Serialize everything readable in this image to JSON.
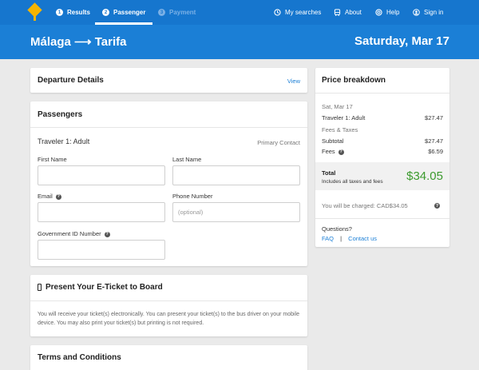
{
  "nav": {
    "steps": [
      {
        "num": "1",
        "label": "Results"
      },
      {
        "num": "2",
        "label": "Passenger"
      },
      {
        "num": "3",
        "label": "Payment"
      }
    ],
    "links": {
      "my_searches": "My searches",
      "about": "About",
      "help": "Help",
      "sign_in": "Sign in"
    }
  },
  "route": {
    "from": "Málaga",
    "arrow": "⟶",
    "to": "Tarifa",
    "date": "Saturday, Mar 17"
  },
  "departure": {
    "title": "Departure Details",
    "view_link": "View"
  },
  "passengers": {
    "title": "Passengers",
    "traveler": "Traveler 1: Adult",
    "primary": "Primary Contact",
    "first_name_label": "First Name",
    "last_name_label": "Last Name",
    "email_label": "Email",
    "phone_label": "Phone Number",
    "phone_placeholder": "(optional)",
    "gov_id_label": "Government ID Number"
  },
  "eticket": {
    "title": "Present Your E-Ticket to Board",
    "text": "You will receive your ticket(s) electronically. You can present your ticket(s) to the bus driver on your mobile device. You may also print your ticket(s) but printing is not required."
  },
  "terms": {
    "title": "Terms and Conditions"
  },
  "price": {
    "title": "Price breakdown",
    "date": "Sat, Mar 17",
    "traveler_label": "Traveler 1: Adult",
    "traveler_amount": "$27.47",
    "fees_taxes_label": "Fees & Taxes",
    "subtotal_label": "Subtotal",
    "subtotal_amount": "$27.47",
    "fees_label": "Fees",
    "fees_amount": "$6.59",
    "total_label": "Total",
    "total_note": "Includes all taxes and fees",
    "total_amount": "$34.05",
    "charged_text": "You will be charged: CAD$34.05",
    "questions": "Questions?",
    "faq": "FAQ",
    "separator": "|",
    "contact": "Contact us"
  },
  "colors": {
    "brand_blue": "#1676ce",
    "accent_green": "#3c9a2e",
    "logo_yellow": "#f5b400"
  }
}
